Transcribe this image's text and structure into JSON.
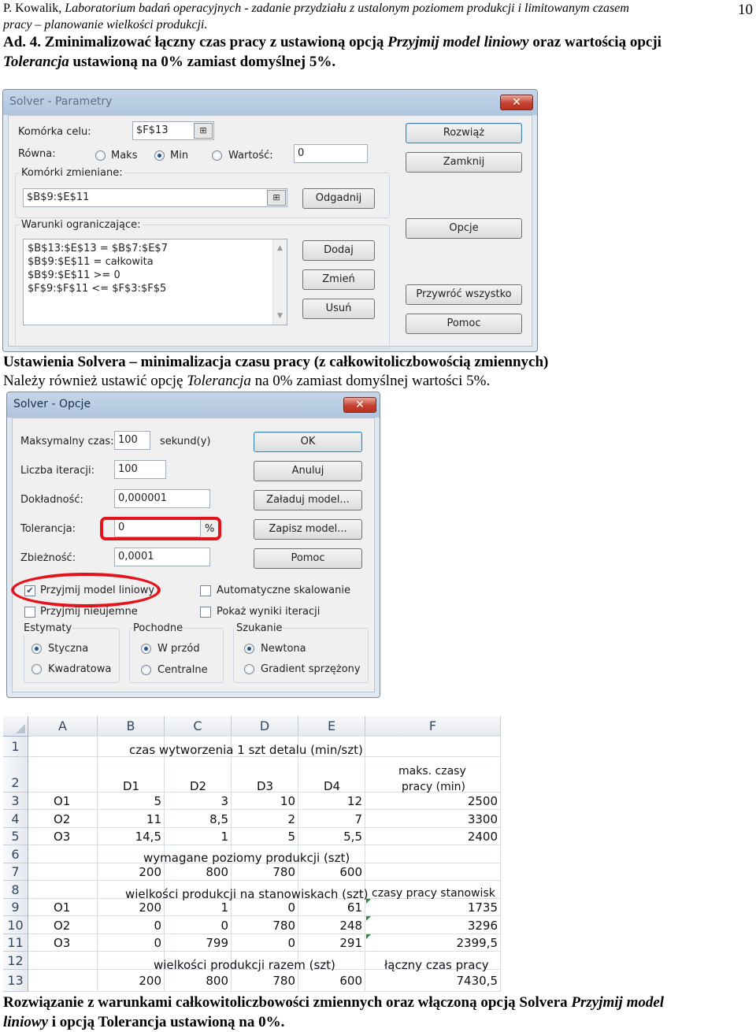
{
  "header": {
    "author": "P. Kowalik, ",
    "title_line1": "Laboratorium badań operacyjnych - zadanie przydziału z ustalonym poziomem produkcji i limitowanym czasem",
    "title_line2": "pracy – planowanie wielkości produkcji.",
    "page_number": "10"
  },
  "task": {
    "p1": "Ad. 4. Zminimalizować łączny czas pracy z ustawioną opcją ",
    "p1_italic": "Przyjmij model liniowy",
    "p2": " oraz wartością opcji",
    "p3_italic": "Tolerancja",
    "p4": " ustawioną na 0% zamiast domyślnej 5%."
  },
  "solver_params": {
    "title": "Solver - Parametry",
    "close": "✕",
    "target_label": "Komórka celu:",
    "target_value": "$F$13",
    "equal_label": "Równa:",
    "opt_max": "Maks",
    "opt_min": "Min",
    "opt_value": "Wartość:",
    "value_field": "0",
    "changing_label": "Komórki zmieniane:",
    "changing_value": "$B$9:$E$11",
    "guess": "Odgadnij",
    "constraints_label": "Warunki ograniczające:",
    "constraints": [
      "$B$13:$E$13 = $B$7:$E$7",
      "$B$9:$E$11 = całkowita",
      "$B$9:$E$11 >= 0",
      "$F$9:$F$11 <= $F$3:$F$5"
    ],
    "add": "Dodaj",
    "change": "Zmień",
    "delete": "Usuń",
    "solve": "Rozwiąż",
    "close_btn": "Zamknij",
    "options": "Opcje",
    "reset": "Przywróć wszystko",
    "help": "Pomoc"
  },
  "caption1": "Ustawienia Solvera – minimalizacja czasu pracy (z całkowitoliczbowością zmiennych)",
  "caption2": {
    "a": "Należy również ustawić opcję ",
    "b": "Tolerancja",
    "c": " na 0% zamiast domyślnej wartości 5%."
  },
  "solver_options": {
    "title": "Solver - Opcje",
    "close": "✕",
    "max_time_label": "Maksymalny czas:",
    "max_time": "100",
    "seconds": "sekund(y)",
    "iter_label": "Liczba iteracji:",
    "iter": "100",
    "precision_label": "Dokładność:",
    "precision": "0,000001",
    "tolerance_label": "Tolerancja:",
    "tolerance": "0",
    "percent": "%",
    "convergence_label": "Zbieżność:",
    "convergence": "0,0001",
    "ok": "OK",
    "cancel": "Anuluj",
    "load": "Załaduj model...",
    "save": "Zapisz model...",
    "help": "Pomoc",
    "linear": "Przyjmij model liniowy",
    "auto_scale": "Automatyczne skalowanie",
    "nonneg": "Przyjmij nieujemne",
    "show_iter": "Pokaż wyniki iteracji",
    "estimates": "Estymaty",
    "est_tangent": "Styczna",
    "est_quad": "Kwadratowa",
    "derivatives": "Pochodne",
    "der_forward": "W przód",
    "der_central": "Centralne",
    "search": "Szukanie",
    "search_newton": "Newtona",
    "search_conj": "Gradient sprzężony"
  },
  "sheet": {
    "cols": [
      "A",
      "B",
      "C",
      "D",
      "E",
      "F"
    ],
    "rows": [
      "1",
      "2",
      "3",
      "4",
      "5",
      "6",
      "7",
      "8",
      "9",
      "10",
      "11",
      "12",
      "13"
    ],
    "r1_title": "czas wytworzenia 1 szt detalu (min/szt)",
    "r2_f_line1": "maks. czasy",
    "r2_f_line2": "pracy (min)",
    "r2_heads": [
      "D1",
      "D2",
      "D3",
      "D4"
    ],
    "times": [
      {
        "name": "O1",
        "vals": [
          "5",
          "3",
          "10",
          "12"
        ],
        "max": "2500"
      },
      {
        "name": "O2",
        "vals": [
          "11",
          "8,5",
          "2",
          "7"
        ],
        "max": "3300"
      },
      {
        "name": "O3",
        "vals": [
          "14,5",
          "1",
          "5",
          "5,5"
        ],
        "max": "2400"
      }
    ],
    "r6_title": "wymagane poziomy produkcji (szt)",
    "r7_vals": [
      "200",
      "800",
      "780",
      "600"
    ],
    "r8_title": "wielkości produkcji na stanowiskach (szt)",
    "r8_f": "czasy pracy stanowisk",
    "prod": [
      {
        "name": "O1",
        "vals": [
          "200",
          "1",
          "0",
          "61"
        ],
        "time": "1735"
      },
      {
        "name": "O2",
        "vals": [
          "0",
          "0",
          "780",
          "248"
        ],
        "time": "3296"
      },
      {
        "name": "O3",
        "vals": [
          "0",
          "799",
          "0",
          "291"
        ],
        "time": "2399,5"
      }
    ],
    "r12_title": "wielkości produkcji razem (szt)",
    "r12_f": "łączny czas pracy",
    "r13_vals": [
      "200",
      "800",
      "780",
      "600"
    ],
    "r13_total": "7430,5"
  },
  "caption3": {
    "a": "Rozwiązanie z warunkami całkowitoliczbowości zmiennych oraz włączoną opcją Solvera ",
    "b": "Przyjmij model",
    "c": "liniowy",
    "d": " i opcją Tolerancja ustawioną na 0%."
  }
}
